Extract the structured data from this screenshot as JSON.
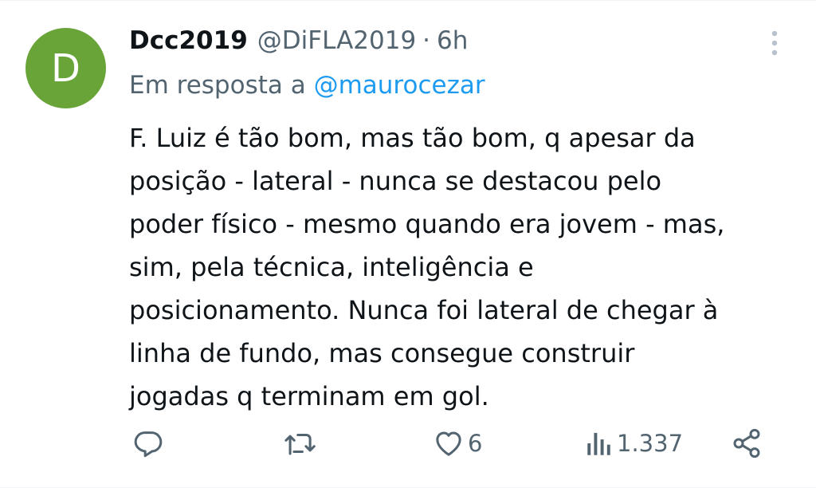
{
  "tweet": {
    "avatar_letter": "D",
    "avatar_color": "#68a438",
    "display_name": "Dcc2019",
    "handle": "@DiFLA2019",
    "separator": "·",
    "time": "6h",
    "reply_prefix": "Em resposta a",
    "reply_to": "@maurocezar",
    "body_lines": [
      "F. Luiz é tão bom, mas tão bom, q apesar da",
      "posição - lateral - nunca se destacou pelo",
      "poder físico - mesmo quando era jovem - mas,",
      "sim, pela técnica, inteligência e",
      "posicionamento. Nunca foi lateral de chegar à",
      "linha de fundo, mas consegue construir",
      "jogadas q terminam em gol."
    ],
    "actions": {
      "reply_icon": "reply-icon",
      "retweet_icon": "retweet-icon",
      "like_icon": "heart-icon",
      "like_count": "6",
      "views_icon": "views-icon",
      "views_count": "1.337",
      "share_icon": "share-icon"
    },
    "colors": {
      "text": "#0f1419",
      "secondary": "#536471",
      "link": "#1d9bf0"
    }
  }
}
